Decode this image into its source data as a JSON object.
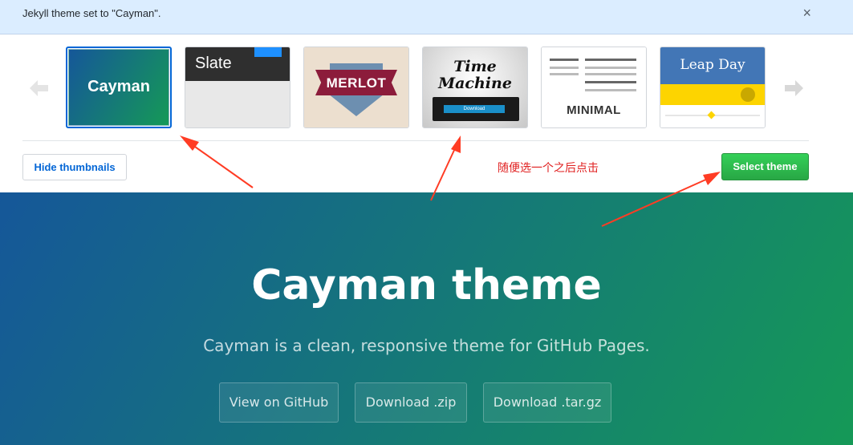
{
  "flash": {
    "message": "Jekyll theme set to \"Cayman\".",
    "close_glyph": "×"
  },
  "themes": [
    {
      "name": "Cayman",
      "label": "Cayman",
      "selected": true
    },
    {
      "name": "Slate",
      "label": "Slate",
      "selected": false
    },
    {
      "name": "Merlot",
      "label": "MERLOT",
      "selected": false
    },
    {
      "name": "Time Machine",
      "label_line1": "Time",
      "label_line2": "Machine",
      "button": "Download",
      "selected": false
    },
    {
      "name": "Minimal",
      "label": "MINIMAL",
      "selected": false
    },
    {
      "name": "Leap Day",
      "label": "Leap Day",
      "selected": false
    }
  ],
  "controls": {
    "hide_thumbnails": "Hide thumbnails",
    "select_theme": "Select theme"
  },
  "annotation": {
    "text": "随便选一个之后点击",
    "color": "#e02020"
  },
  "hero": {
    "title": "Cayman theme",
    "subtitle": "Cayman is a clean, responsive theme for GitHub Pages.",
    "buttons": [
      "View on GitHub",
      "Download .zip",
      "Download .tar.gz"
    ]
  },
  "colors": {
    "accent": "#0366d6",
    "success": "#28a745",
    "hero_start": "#155799",
    "hero_end": "#159957"
  },
  "icons": {
    "prev": "chevron-left-icon",
    "next": "chevron-right-icon",
    "close": "close-icon"
  }
}
